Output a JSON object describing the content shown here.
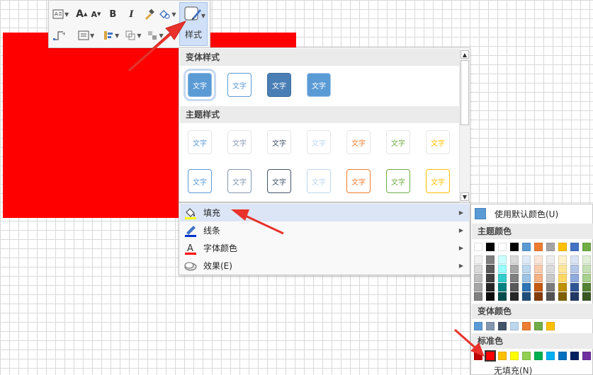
{
  "toolbar": {
    "style_label": "样式",
    "bold_label": "B",
    "italic_label": "I",
    "font_grow_label": "A",
    "font_shrink_label": "A"
  },
  "style_panel": {
    "variant_header": "变体样式",
    "theme_header": "主题样式",
    "sample_text": "文字",
    "variant_swatches": [
      {
        "bg": "#5b9bd5",
        "border": "#8fb7e0",
        "fg": "#ffffff"
      },
      {
        "bg": "#ffffff",
        "border": "#5b9bd5",
        "fg": "#5b9bd5"
      },
      {
        "bg": "#4a7fb5",
        "border": "#3f6d9c",
        "fg": "#ffffff"
      },
      {
        "bg": "#5b9bd5",
        "border": "#a8c7e8",
        "fg": "#ffffff"
      }
    ],
    "theme_colors_row1": [
      "#5b9bd5",
      "#8497b0",
      "#44546a",
      "#bdd7ee",
      "#ed7d31",
      "#70ad47",
      "#ffc000"
    ],
    "theme_colors_row2": [
      "#5b9bd5",
      "#8497b0",
      "#44546a",
      "#bdd7ee",
      "#ed7d31",
      "#70ad47",
      "#ffc000"
    ]
  },
  "menu": {
    "items": [
      {
        "label": "填充",
        "icon": "paint-bucket-icon"
      },
      {
        "label": "线条",
        "icon": "pen-line-icon"
      },
      {
        "label": "字体颜色",
        "icon": "font-color-icon"
      },
      {
        "label": "效果(E)",
        "icon": "effects-icon"
      }
    ]
  },
  "color_panel": {
    "default_label": "使用默认颜色(U)",
    "default_color": "#5b9bd5",
    "theme_header": "主题颜色",
    "variant_header": "变体颜色",
    "standard_header": "标准色",
    "no_fill_label": "无填充(N)",
    "theme_top": [
      "#ffffff",
      "#000000",
      "#ffffff",
      "#000000",
      "#5b9bd5",
      "#ed7d31",
      "#a5a5a5",
      "#ffc000",
      "#4472c4",
      "#70ad47"
    ],
    "theme_columns": [
      [
        "#f2f2f2",
        "#d9d9d9",
        "#bfbfbf",
        "#a6a6a6",
        "#808080"
      ],
      [
        "#7f7f7f",
        "#595959",
        "#404040",
        "#262626",
        "#0d0d0d"
      ],
      [
        "#ccffff",
        "#99ffff",
        "#33cccc",
        "#008080",
        "#004d4d"
      ],
      [
        "#d9d9d9",
        "#a6a6a6",
        "#7f7f7f",
        "#595959",
        "#262626"
      ],
      [
        "#deebf7",
        "#bdd7ee",
        "#9dc3e6",
        "#2e75b6",
        "#1f4e79"
      ],
      [
        "#fbe5d6",
        "#f8cbad",
        "#f4b183",
        "#c55a11",
        "#843c0c"
      ],
      [
        "#ededed",
        "#dbdbdb",
        "#c9c9c9",
        "#7b7b7b",
        "#525252"
      ],
      [
        "#fff2cc",
        "#ffe699",
        "#ffd966",
        "#bf9000",
        "#7f6000"
      ],
      [
        "#dae3f3",
        "#b4c7e7",
        "#8faadc",
        "#2f5597",
        "#203864"
      ],
      [
        "#e2f0d9",
        "#c5e0b4",
        "#a9d18e",
        "#548235",
        "#385723"
      ]
    ],
    "variant_colors": [
      "#5b9bd5",
      "#8497b0",
      "#44546a",
      "#bdd7ee",
      "#ed7d31",
      "#70ad47",
      "#ffc000"
    ],
    "standard_colors": [
      "#c00000",
      "#ff0000",
      "#ffc000",
      "#ffff00",
      "#92d050",
      "#00b050",
      "#00b0f0",
      "#0070c0",
      "#002060",
      "#7030a0"
    ]
  }
}
